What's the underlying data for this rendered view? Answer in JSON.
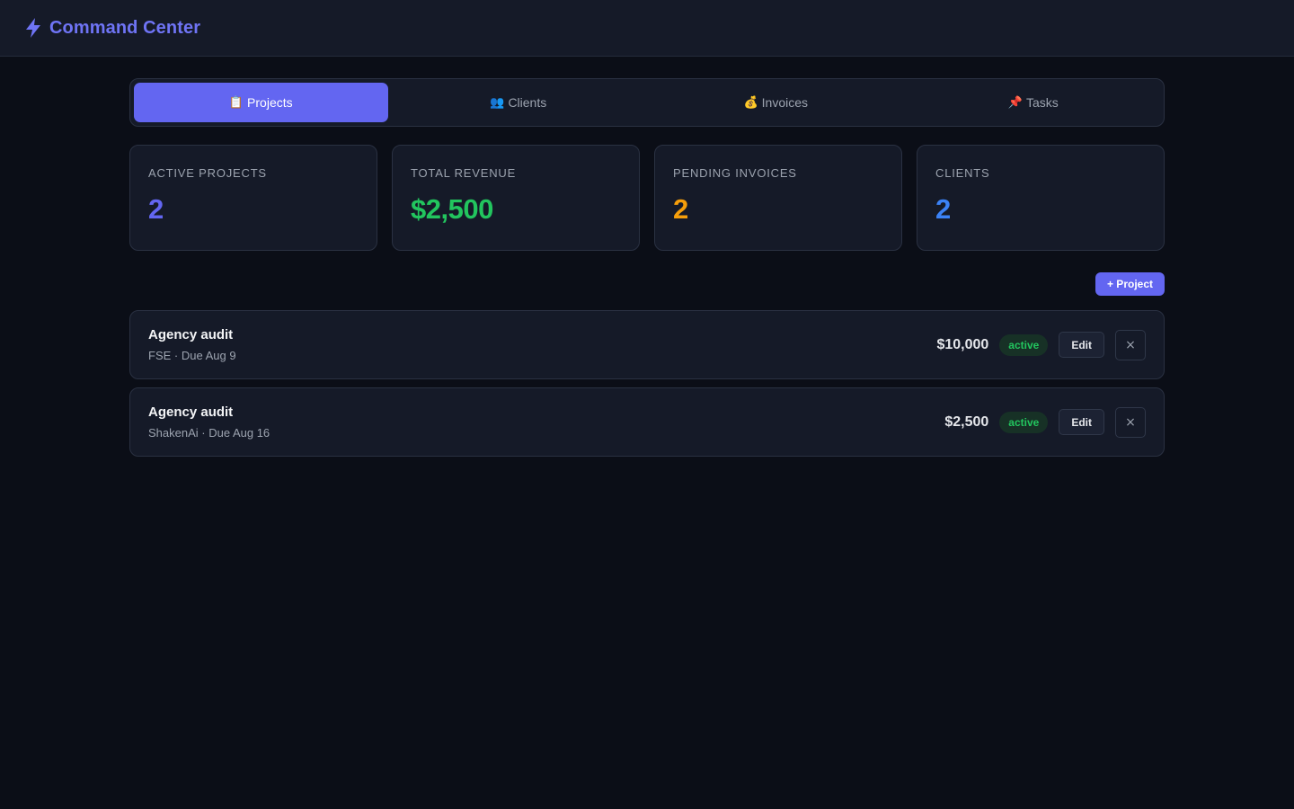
{
  "app": {
    "title": "Command Center",
    "icon": "lightning-bolt-icon",
    "accent_color": "#6366f1"
  },
  "tabs": [
    {
      "emoji": "📋",
      "icon": "clipboard-icon",
      "label": "Projects",
      "active": true
    },
    {
      "emoji": "👥",
      "icon": "people-icon",
      "label": "Clients",
      "active": false
    },
    {
      "emoji": "💰",
      "icon": "money-bag-icon",
      "label": "Invoices",
      "active": false
    },
    {
      "emoji": "📌",
      "icon": "pushpin-icon",
      "label": "Tasks",
      "active": false
    }
  ],
  "stats": [
    {
      "label": "ACTIVE PROJECTS",
      "value": "2",
      "color": "#6366f1"
    },
    {
      "label": "TOTAL REVENUE",
      "value": "$2,500",
      "color": "#22c55e"
    },
    {
      "label": "PENDING INVOICES",
      "value": "2",
      "color": "#f59e0b"
    },
    {
      "label": "CLIENTS",
      "value": "2",
      "color": "#3b82f6"
    }
  ],
  "toolbar": {
    "add_label": "+ Project"
  },
  "projects": [
    {
      "title": "Agency audit",
      "meta": "FSE · Due Aug 9",
      "amount": "$10,000",
      "status": "active",
      "edit_label": "Edit",
      "delete_label": "×"
    },
    {
      "title": "Agency audit",
      "meta": "ShakenAi · Due Aug 16",
      "amount": "$2,500",
      "status": "active",
      "edit_label": "Edit",
      "delete_label": "×"
    }
  ],
  "status_color": "#22c55e"
}
